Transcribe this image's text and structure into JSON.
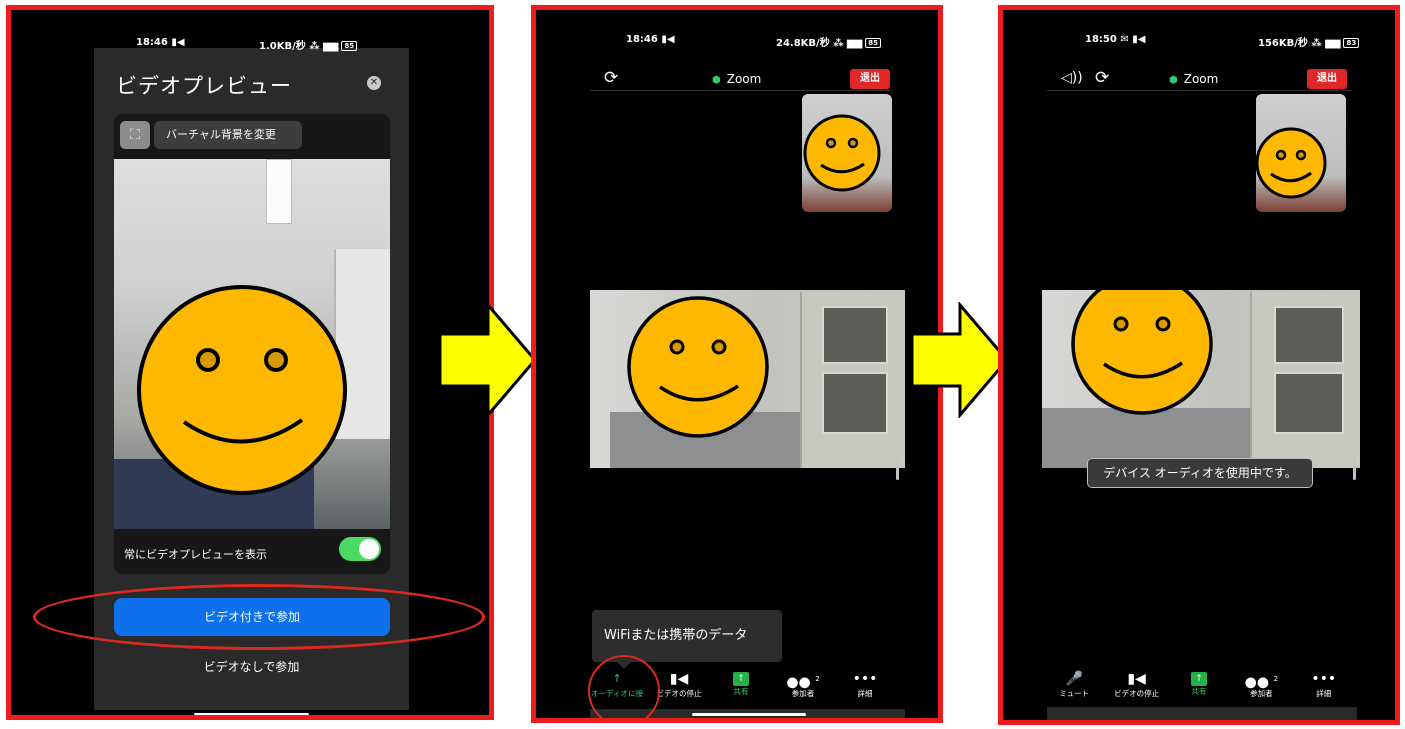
{
  "colors": {
    "frame": "#ee1c1c",
    "leave": "#e02828",
    "join": "#0e71eb",
    "toggle": "#4cd964",
    "share": "#24b14a",
    "arrow": "#ffff00",
    "emoji": "#ffb800"
  },
  "preview": {
    "status_time": "18:46",
    "status_speed": "1.0KB/秒",
    "battery": "85",
    "title": "ビデオプレビュー",
    "virtual_background": "バーチャル背景を変更",
    "always_show_preview": "常にビデオプレビューを表示",
    "always_show_preview_on": true,
    "join_with_video": "ビデオ付きで参加",
    "join_without_video": "ビデオなしで参加"
  },
  "meeting1": {
    "status_time": "18:46",
    "status_speed": "24.8KB/秒",
    "battery": "85",
    "title": "Zoom",
    "leave": "退出",
    "toast": "WiFiまたは携帯のデータ",
    "toolbar": [
      {
        "icon": "arrow-up-icon",
        "glyph": "↑",
        "label": "オーディオに接"
      },
      {
        "icon": "video-camera-icon",
        "glyph": "■◀",
        "label": "ビデオの停止"
      },
      {
        "icon": "share-icon",
        "glyph": "↑",
        "label": "共有"
      },
      {
        "icon": "participants-icon",
        "glyph": "👥",
        "label": "参加者",
        "count": "2"
      },
      {
        "icon": "more-icon",
        "glyph": "•••",
        "label": "詳細"
      }
    ]
  },
  "meeting2": {
    "status_time": "18:50",
    "status_speed": "156KB/秒",
    "battery": "83",
    "title": "Zoom",
    "leave": "退出",
    "toast": "デバイス オーディオを使用中です。",
    "toolbar": [
      {
        "icon": "microphone-icon",
        "glyph": "🎤",
        "label": "ミュート"
      },
      {
        "icon": "video-camera-icon",
        "glyph": "■◀",
        "label": "ビデオの停止"
      },
      {
        "icon": "share-icon",
        "glyph": "↑",
        "label": "共有"
      },
      {
        "icon": "participants-icon",
        "glyph": "👥",
        "label": "参加者",
        "count": "2"
      },
      {
        "icon": "more-icon",
        "glyph": "•••",
        "label": "詳細"
      }
    ]
  }
}
